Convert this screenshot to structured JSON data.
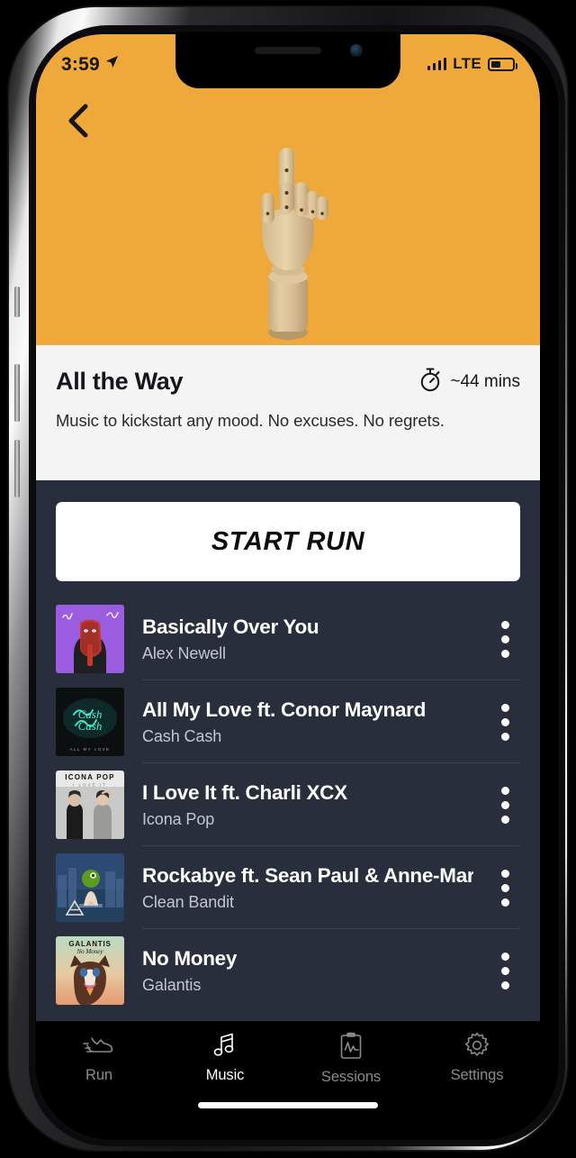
{
  "status_bar": {
    "time": "3:59",
    "location_icon": "location-arrow-icon",
    "signal_icon": "cellular-signal-icon",
    "network": "LTE",
    "battery_icon": "battery-icon",
    "battery_level_percent": 38
  },
  "header": {
    "back_icon": "chevron-left-icon",
    "hero_image_alt": "wooden-mannequin-hand-pointing-up",
    "background_color": "#EFA93A"
  },
  "playlist": {
    "title": "All the Way",
    "duration_icon": "stopwatch-icon",
    "duration": "~44 mins",
    "description": "Music to kickstart any mood. No excuses. No regrets."
  },
  "actions": {
    "start_run_label": "START RUN"
  },
  "tracks": [
    {
      "title": "Basically Over You",
      "artist": "Alex Newell",
      "art_name": "album-art-basically-over-you",
      "menu_icon": "kebab-menu-icon"
    },
    {
      "title": "All My Love ft. Conor Maynard",
      "artist": "Cash Cash",
      "art_name": "album-art-all-my-love",
      "menu_icon": "kebab-menu-icon"
    },
    {
      "title": "I Love It ft. Charli XCX",
      "artist": "Icona Pop",
      "art_name": "album-art-i-love-it",
      "menu_icon": "kebab-menu-icon"
    },
    {
      "title": "Rockabye ft. Sean Paul & Anne-Marie",
      "artist": "Clean Bandit",
      "art_name": "album-art-rockabye",
      "menu_icon": "kebab-menu-icon"
    },
    {
      "title": "No Money",
      "artist": "Galantis",
      "art_name": "album-art-no-money",
      "menu_icon": "kebab-menu-icon"
    }
  ],
  "tab_bar": {
    "items": [
      {
        "label": "Run",
        "icon": "running-shoe-icon",
        "active": false
      },
      {
        "label": "Music",
        "icon": "music-note-icon",
        "active": true
      },
      {
        "label": "Sessions",
        "icon": "clipboard-chart-icon",
        "active": false
      },
      {
        "label": "Settings",
        "icon": "gear-icon",
        "active": false
      }
    ]
  },
  "colors": {
    "accent_orange": "#EFA93A",
    "dark_navy": "#282E3C",
    "panel_light": "#F4F4F4",
    "divider": "#3A4152",
    "muted_text": "#C3C7CE"
  }
}
